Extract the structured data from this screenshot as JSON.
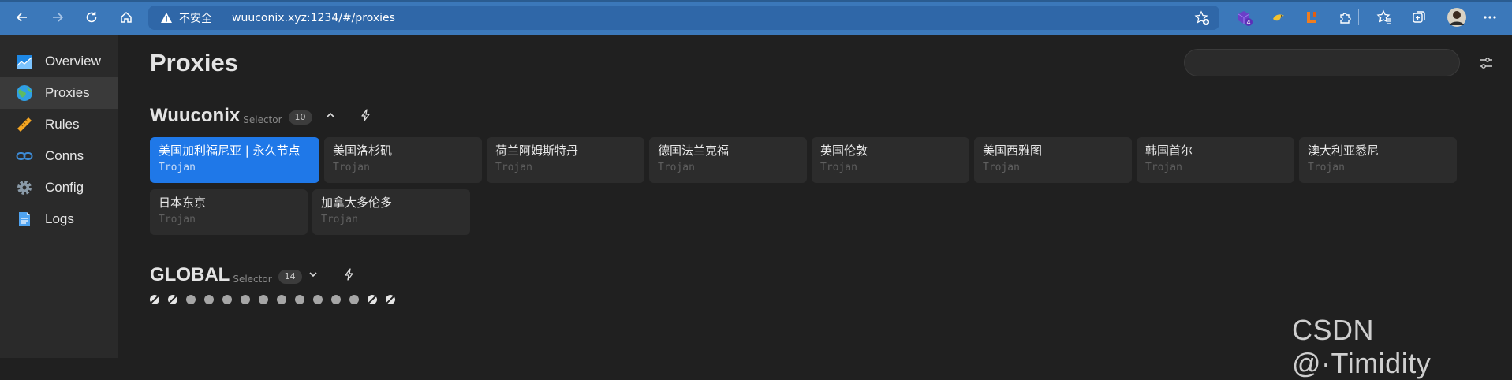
{
  "browser": {
    "security_label": "不安全",
    "url": "wuuconix.xyz:1234/#/proxies",
    "extension_badge": "4"
  },
  "sidebar": {
    "items": [
      {
        "label": "Overview",
        "icon": "chart-icon"
      },
      {
        "label": "Proxies",
        "icon": "globe-icon",
        "active": true
      },
      {
        "label": "Rules",
        "icon": "ruler-icon"
      },
      {
        "label": "Conns",
        "icon": "link-icon"
      },
      {
        "label": "Config",
        "icon": "gear-icon"
      },
      {
        "label": "Logs",
        "icon": "document-icon"
      }
    ]
  },
  "main": {
    "title": "Proxies",
    "search_placeholder": ""
  },
  "groups": [
    {
      "name": "Wuuconix",
      "type": "Selector",
      "count": "10",
      "expanded": true,
      "proxies": [
        {
          "name": "美国加利福尼亚 | 永久节点",
          "type": "Trojan",
          "selected": true
        },
        {
          "name": "美国洛杉矶",
          "type": "Trojan"
        },
        {
          "name": "荷兰阿姆斯特丹",
          "type": "Trojan"
        },
        {
          "name": "德国法兰克福",
          "type": "Trojan"
        },
        {
          "name": "英国伦敦",
          "type": "Trojan"
        },
        {
          "name": "美国西雅图",
          "type": "Trojan"
        },
        {
          "name": "韩国首尔",
          "type": "Trojan"
        },
        {
          "name": "澳大利亚悉尼",
          "type": "Trojan"
        },
        {
          "name": "日本东京",
          "type": "Trojan"
        },
        {
          "name": "加拿大多伦多",
          "type": "Trojan"
        }
      ]
    },
    {
      "name": "GLOBAL",
      "type": "Selector",
      "count": "14",
      "expanded": false,
      "dots": [
        "striped",
        "striped",
        "plain",
        "plain",
        "plain",
        "plain",
        "plain",
        "plain",
        "plain",
        "plain",
        "plain",
        "plain",
        "striped",
        "striped"
      ]
    }
  ],
  "watermark": "CSDN @·Timidity",
  "colors": {
    "accent": "#1f78e8",
    "browser_bar": "#3b78ba",
    "sidebar_bg": "#2a2a2a",
    "main_bg": "#202020"
  }
}
